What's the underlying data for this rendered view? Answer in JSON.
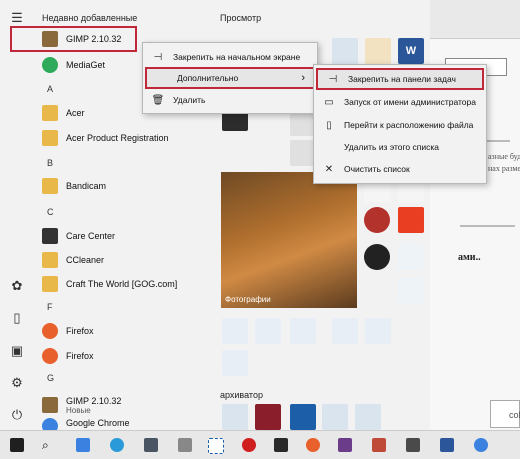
{
  "start_menu": {
    "recent_header": "Недавно добавленные",
    "tiles_header": "Просмотр",
    "tiles_footer_header": "архиватор",
    "photo_tile_label": "Фотографии",
    "apps": [
      {
        "label": "GIMP 2.10.32",
        "icon_color": "#8a6a3c",
        "icon": "gimp-icon"
      },
      {
        "label": "MediaGet",
        "icon_color": "#2eaa5a",
        "icon": "mediaget-icon"
      },
      {
        "label": "Acer",
        "icon_color": "#e8b84a",
        "icon": "folder-icon"
      },
      {
        "label": "Acer Product Registration",
        "icon_color": "#e8b84a",
        "icon": "folder-icon"
      },
      {
        "label": "Bandicam",
        "icon_color": "#e8b84a",
        "icon": "folder-icon"
      },
      {
        "label": "Care Center",
        "icon_color": "#333333",
        "icon": "care-center-icon"
      },
      {
        "label": "CCleaner",
        "icon_color": "#e8b84a",
        "icon": "folder-icon"
      },
      {
        "label": "Craft The World [GOG.com]",
        "icon_color": "#e8b84a",
        "icon": "folder-icon"
      },
      {
        "label": "Firefox",
        "icon_color": "#e8612c",
        "icon": "firefox-icon"
      },
      {
        "label": "Firefox",
        "icon_color": "#e8612c",
        "icon": "firefox-icon"
      },
      {
        "label": "GIMP 2.10.32",
        "icon_color": "#8a6a3c",
        "icon": "gimp-icon"
      },
      {
        "label": "Google Chrome",
        "icon_color": "#3b82e0",
        "icon": "chrome-icon"
      }
    ],
    "new_badge": "Новые",
    "letters": [
      "A",
      "B",
      "C",
      "F",
      "G"
    ]
  },
  "context_menu": {
    "items": [
      {
        "label": "Закрепить на начальном экране",
        "icon": "pin-icon"
      },
      {
        "label": "Дополнительно",
        "icon": "more-icon",
        "arrow": "›"
      },
      {
        "label": "Удалить",
        "icon": "trash-icon"
      }
    ]
  },
  "submenu": {
    "items": [
      {
        "label": "Закрепить на панели задач",
        "icon": "pin-taskbar-icon"
      },
      {
        "label": "Запуск от имени администратора",
        "icon": "admin-icon"
      },
      {
        "label": "Перейти к расположению файла",
        "icon": "file-location-icon"
      },
      {
        "label": "Удалить из этого списка",
        "icon": "none"
      },
      {
        "label": "Очистить список",
        "icon": "clear-icon"
      }
    ]
  },
  "doc_window": {
    "line1": "азные буде",
    "line2": "нах разме",
    "heading": "ами..",
    "tab": "colla"
  },
  "colors": {
    "highlight": "#c0283a",
    "menu_bg": "#f2f2f2"
  }
}
